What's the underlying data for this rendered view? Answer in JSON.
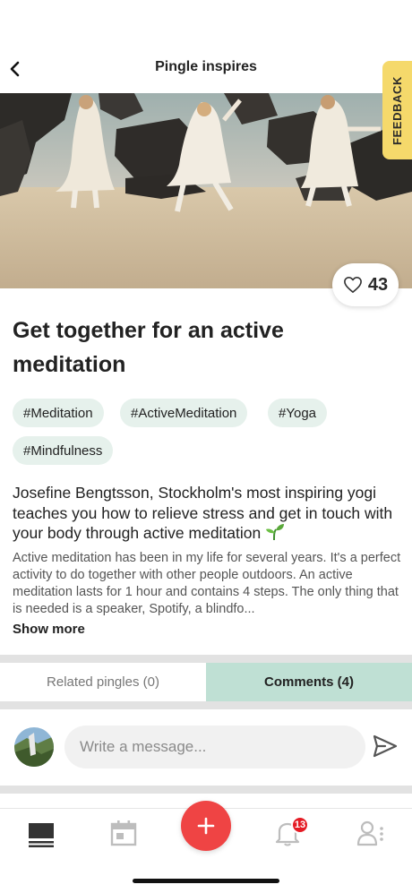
{
  "header": {
    "title": "Pingle inspires",
    "back_icon": "chevron-left-icon"
  },
  "feedback_label": "FEEDBACK",
  "likes": {
    "count": "43",
    "icon": "heart-outline-icon"
  },
  "post": {
    "headline": "Get together for an active meditation",
    "tags": [
      "#Meditation",
      "#ActiveMeditation",
      "#Yoga",
      "#Mindfulness"
    ],
    "lead": "Josefine Bengtsson, Stockholm's most inspiring yogi teaches you how to relieve stress and get in touch with your body through active meditation",
    "body": "Active meditation has been in my life for several years. It's a perfect activity to do together with other people outdoors. An active meditation lasts for 1 hour and contains 4 steps. The only thing that is needed is a speaker, Spotify, a blindfo...",
    "show_more": "Show more"
  },
  "tabs": [
    {
      "label": "Related pingles (0)",
      "active": false
    },
    {
      "label": "Comments (4)",
      "active": true
    }
  ],
  "comment": {
    "placeholder": "Write a message...",
    "send_icon": "send-icon"
  },
  "nav": {
    "items": [
      "feed-icon",
      "calendar-icon",
      "add-icon",
      "bell-icon",
      "profile-icon"
    ],
    "notification_badge": "13"
  },
  "colors": {
    "accent_tab": "#bfe0d4",
    "tag_bg": "#e6f1ec",
    "fab": "#ef4444",
    "feedback": "#f5d96b",
    "badge": "#e51b24"
  }
}
